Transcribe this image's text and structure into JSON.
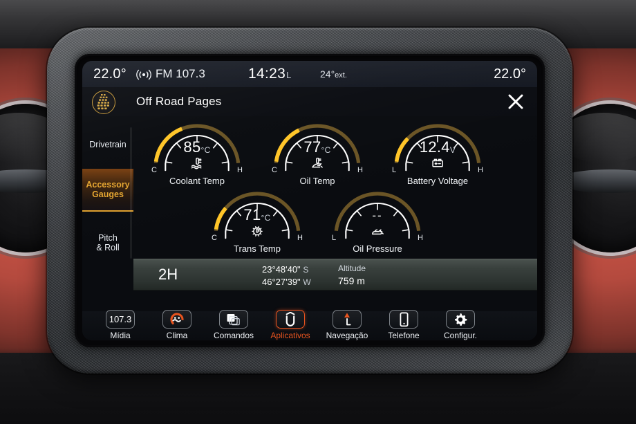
{
  "status_bar": {
    "left_temp": "22.0°",
    "radio_icon": "radio-signal-icon",
    "radio_band": "FM 107.3",
    "clock": "14:23",
    "clock_suffix": "L",
    "exterior_temp": "24°",
    "exterior_label": "ext.",
    "right_temp": "22.0°"
  },
  "title_bar": {
    "badge_icon": "tire-tread-badge-icon",
    "title": "Off Road Pages",
    "close_icon": "close-icon"
  },
  "sidebar": {
    "items": [
      {
        "label": "Drivetrain",
        "active": false
      },
      {
        "label": "Accessory\nGauges",
        "line1": "Accessory",
        "line2": "Gauges",
        "active": true
      },
      {
        "label": "Pitch\n& Roll",
        "line1": "Pitch",
        "line2": "& Roll",
        "active": false
      }
    ]
  },
  "gauges": [
    {
      "name": "Coolant Temp",
      "value": "85",
      "unit": "°C",
      "unit_main": "°",
      "unit_sub": "C",
      "min_label": "C",
      "max_label": "H",
      "fill": 0.37,
      "icon": "coolant-temp-icon"
    },
    {
      "name": "Oil Temp",
      "value": "77",
      "unit": "°C",
      "unit_main": "°",
      "unit_sub": "C",
      "min_label": "C",
      "max_label": "H",
      "fill": 0.34,
      "icon": "oil-temp-icon"
    },
    {
      "name": "Battery Voltage",
      "value": "12.4",
      "unit": "V",
      "unit_main": "",
      "unit_sub": "V",
      "min_label": "L",
      "max_label": "H",
      "fill": 0.22,
      "icon": "battery-icon"
    },
    {
      "name": "Trans Temp",
      "value": "71",
      "unit": "°C",
      "unit_main": "°",
      "unit_sub": "C",
      "min_label": "C",
      "max_label": "H",
      "fill": 0.2,
      "icon": "trans-temp-icon"
    },
    {
      "name": "Oil Pressure",
      "value": "--",
      "unit": "",
      "unit_main": "",
      "unit_sub": "",
      "min_label": "L",
      "max_label": "H",
      "fill": 0.0,
      "icon": "oil-pressure-icon"
    }
  ],
  "info_bar": {
    "drive_mode": "2H",
    "latitude": "23°48'40\"",
    "latitude_dir": "S",
    "longitude": "46°27'39\"",
    "longitude_dir": "W",
    "altitude_label": "Altitude",
    "altitude_value": "759 m"
  },
  "taskbar": {
    "items": [
      {
        "label": "Mídia",
        "icon": "radio-frequency-icon",
        "text": "107.3",
        "active": false
      },
      {
        "label": "Clima",
        "icon": "climate-fan-icon",
        "active": false
      },
      {
        "label": "Comandos",
        "icon": "app-windows-icon",
        "active": false
      },
      {
        "label": "Aplicativos",
        "icon": "uconnect-icon",
        "active": true
      },
      {
        "label": "Navegação",
        "icon": "navigation-arrow-icon",
        "active": false
      },
      {
        "label": "Telefone",
        "icon": "phone-icon",
        "active": false
      },
      {
        "label": "Configur.",
        "icon": "gear-icon",
        "active": false
      }
    ]
  },
  "colors": {
    "amber": "#f0b429",
    "amber_bright": "#ffc528",
    "accent_orange": "#e8541f",
    "sidebar_active_text": "#e5a530",
    "screen_bg": "#0a0c10",
    "dash_red": "#c24f42"
  }
}
